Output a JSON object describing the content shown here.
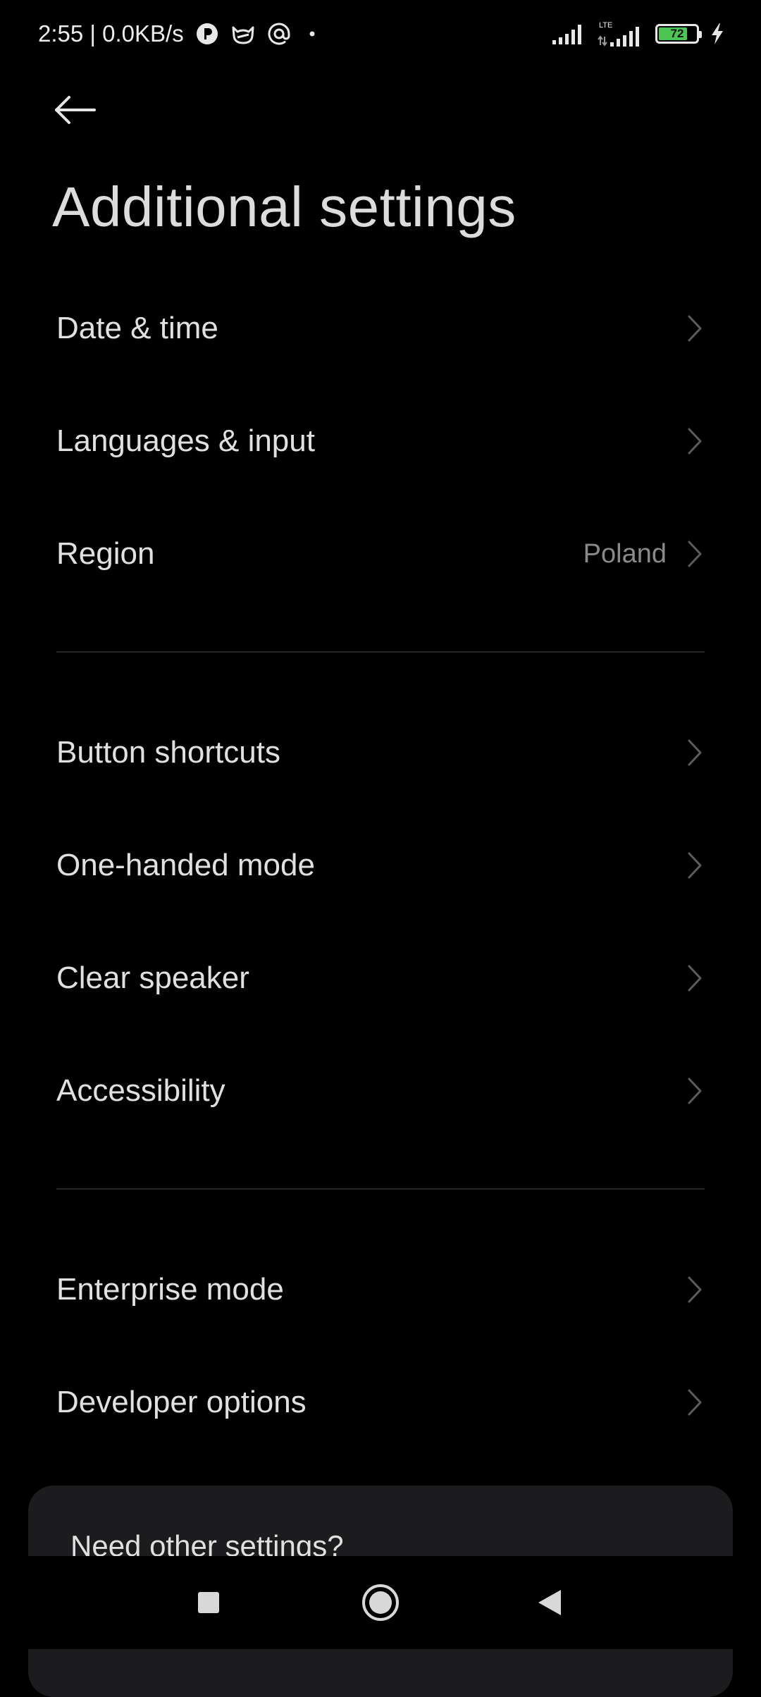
{
  "status_bar": {
    "time_speed": "2:55 | 0.0KB/s",
    "network_label": "LTE",
    "battery_level": "72",
    "icons_left": [
      "p-badge-icon",
      "cat-icon",
      "at-sign-icon",
      "dot-icon"
    ],
    "icons_right": [
      "signal-icon",
      "lte-signal-icon",
      "battery-icon",
      "charging-icon"
    ]
  },
  "header": {
    "title": "Additional settings"
  },
  "groups": [
    {
      "items": [
        {
          "label": "Date & time",
          "value": ""
        },
        {
          "label": "Languages & input",
          "value": ""
        },
        {
          "label": "Region",
          "value": "Poland"
        }
      ]
    },
    {
      "items": [
        {
          "label": "Button shortcuts",
          "value": ""
        },
        {
          "label": "One-handed mode",
          "value": ""
        },
        {
          "label": "Clear speaker",
          "value": ""
        },
        {
          "label": "Accessibility",
          "value": ""
        }
      ]
    },
    {
      "items": [
        {
          "label": "Enterprise mode",
          "value": ""
        },
        {
          "label": "Developer options",
          "value": ""
        }
      ]
    }
  ],
  "help_card": {
    "title": "Need other settings?"
  },
  "colors": {
    "background": "#000000",
    "card": "#1c1c1e",
    "text": "#e0e0e0",
    "secondary_text": "#8a8a8a",
    "battery_fill": "#4cc552"
  }
}
